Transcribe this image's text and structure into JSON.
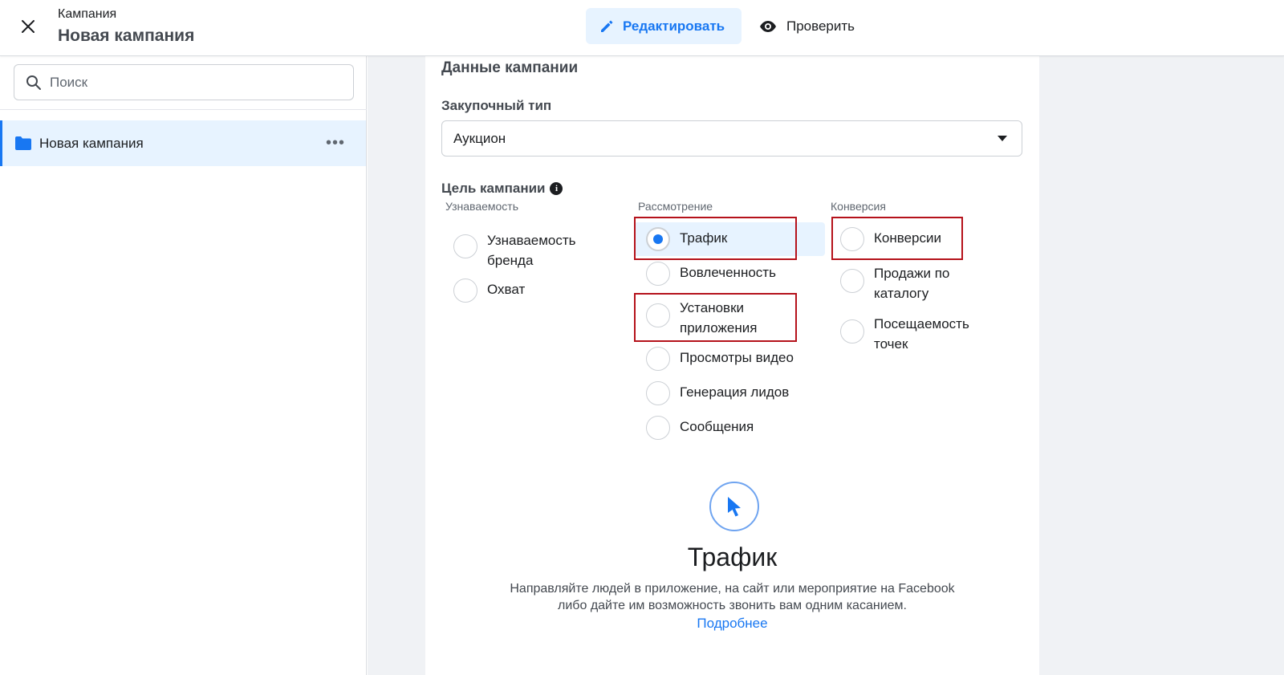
{
  "header": {
    "subtitle": "Кампания",
    "title": "Новая кампания",
    "edit_label": "Редактировать",
    "review_label": "Проверить"
  },
  "sidebar": {
    "search_placeholder": "Поиск",
    "items": [
      {
        "label": "Новая кампания",
        "icon": "folder-icon",
        "selected": true
      }
    ]
  },
  "main": {
    "section_title": "Данные кампании",
    "buying_type": {
      "label": "Закупочный тип",
      "value": "Аукцион"
    },
    "objective": {
      "label": "Цель кампании",
      "columns": [
        {
          "heading": "Узнаваемость",
          "options": [
            "Узнаваемость бренда",
            "Охват"
          ]
        },
        {
          "heading": "Рассмотрение",
          "options": [
            "Трафик",
            "Вовлеченность",
            "Установки приложения",
            "Просмотры видео",
            "Генерация лидов",
            "Сообщения"
          ]
        },
        {
          "heading": "Конверсия",
          "options": [
            "Конверсии",
            "Продажи по каталогу",
            "Посещаемость точек"
          ]
        }
      ],
      "selected": "Трафик"
    },
    "detail": {
      "icon": "cursor-icon",
      "title": "Трафик",
      "description": "Направляйте людей в приложение, на сайт или мероприятие на Facebook либо дайте им возможность звонить вам одним касанием.",
      "link": "Подробнее"
    }
  },
  "colors": {
    "accent": "#1877f2",
    "highlight": "#e7f3ff",
    "annotation": "#b5121b"
  }
}
